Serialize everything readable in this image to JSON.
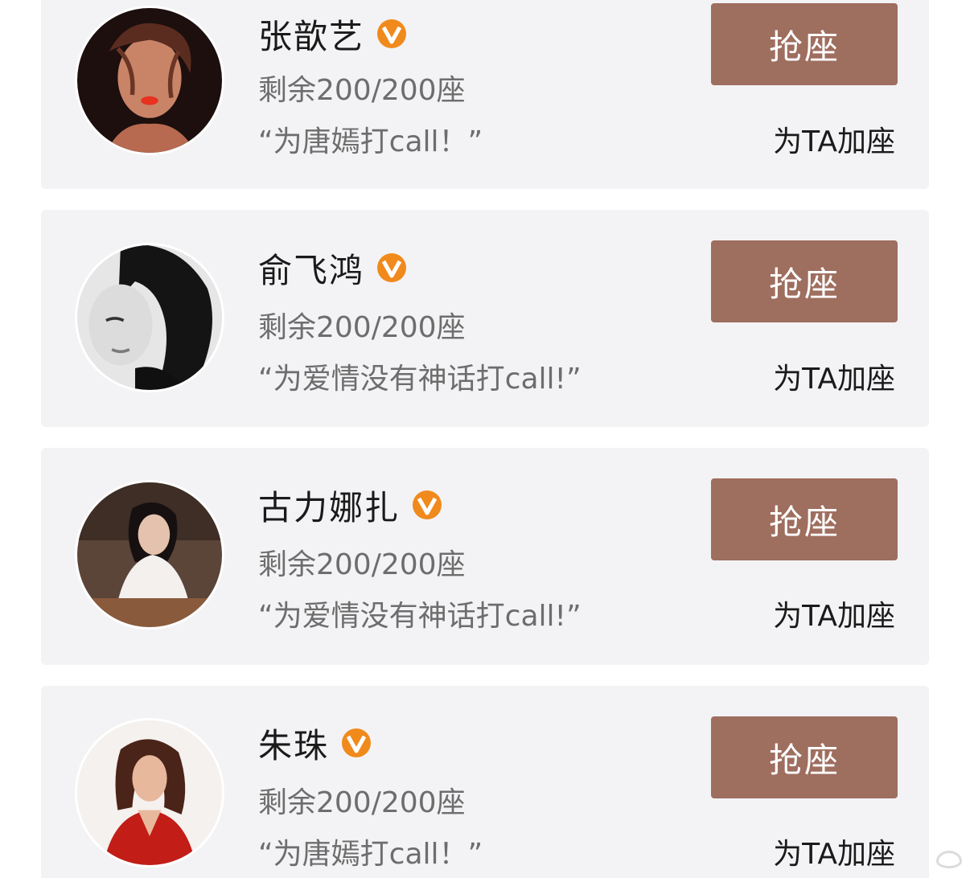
{
  "colors": {
    "card_bg": "#f3f3f5",
    "button_bg": "#9e6e5f",
    "badge": "#f08a1c",
    "secondary_text": "#6d6d6d",
    "primary_text": "#1a1a1a"
  },
  "cards": [
    {
      "name": "张歆艺",
      "verified_icon": "orange-v-badge",
      "remaining": "剩余200/200座",
      "quote": "“为唐嫣打call！”",
      "grab_label": "抢座",
      "add_label": "为TA加座",
      "avatar_icon": "woman-portrait-dark-red"
    },
    {
      "name": "俞飞鸿",
      "verified_icon": "orange-v-badge",
      "remaining": "剩余200/200座",
      "quote": "“为爱情没有神话打call!”",
      "grab_label": "抢座",
      "add_label": "为TA加座",
      "avatar_icon": "woman-portrait-black-white"
    },
    {
      "name": "古力娜扎",
      "verified_icon": "orange-v-badge",
      "remaining": "剩余200/200座",
      "quote": "“为爱情没有神话打call!”",
      "grab_label": "抢座",
      "add_label": "为TA加座",
      "avatar_icon": "woman-portrait-white-sweater"
    },
    {
      "name": "朱珠",
      "verified_icon": "orange-v-badge",
      "remaining": "剩余200/200座",
      "quote": "“为唐嫣打call！”",
      "grab_label": "抢座",
      "add_label": "为TA加座",
      "avatar_icon": "woman-portrait-red-dress"
    }
  ]
}
